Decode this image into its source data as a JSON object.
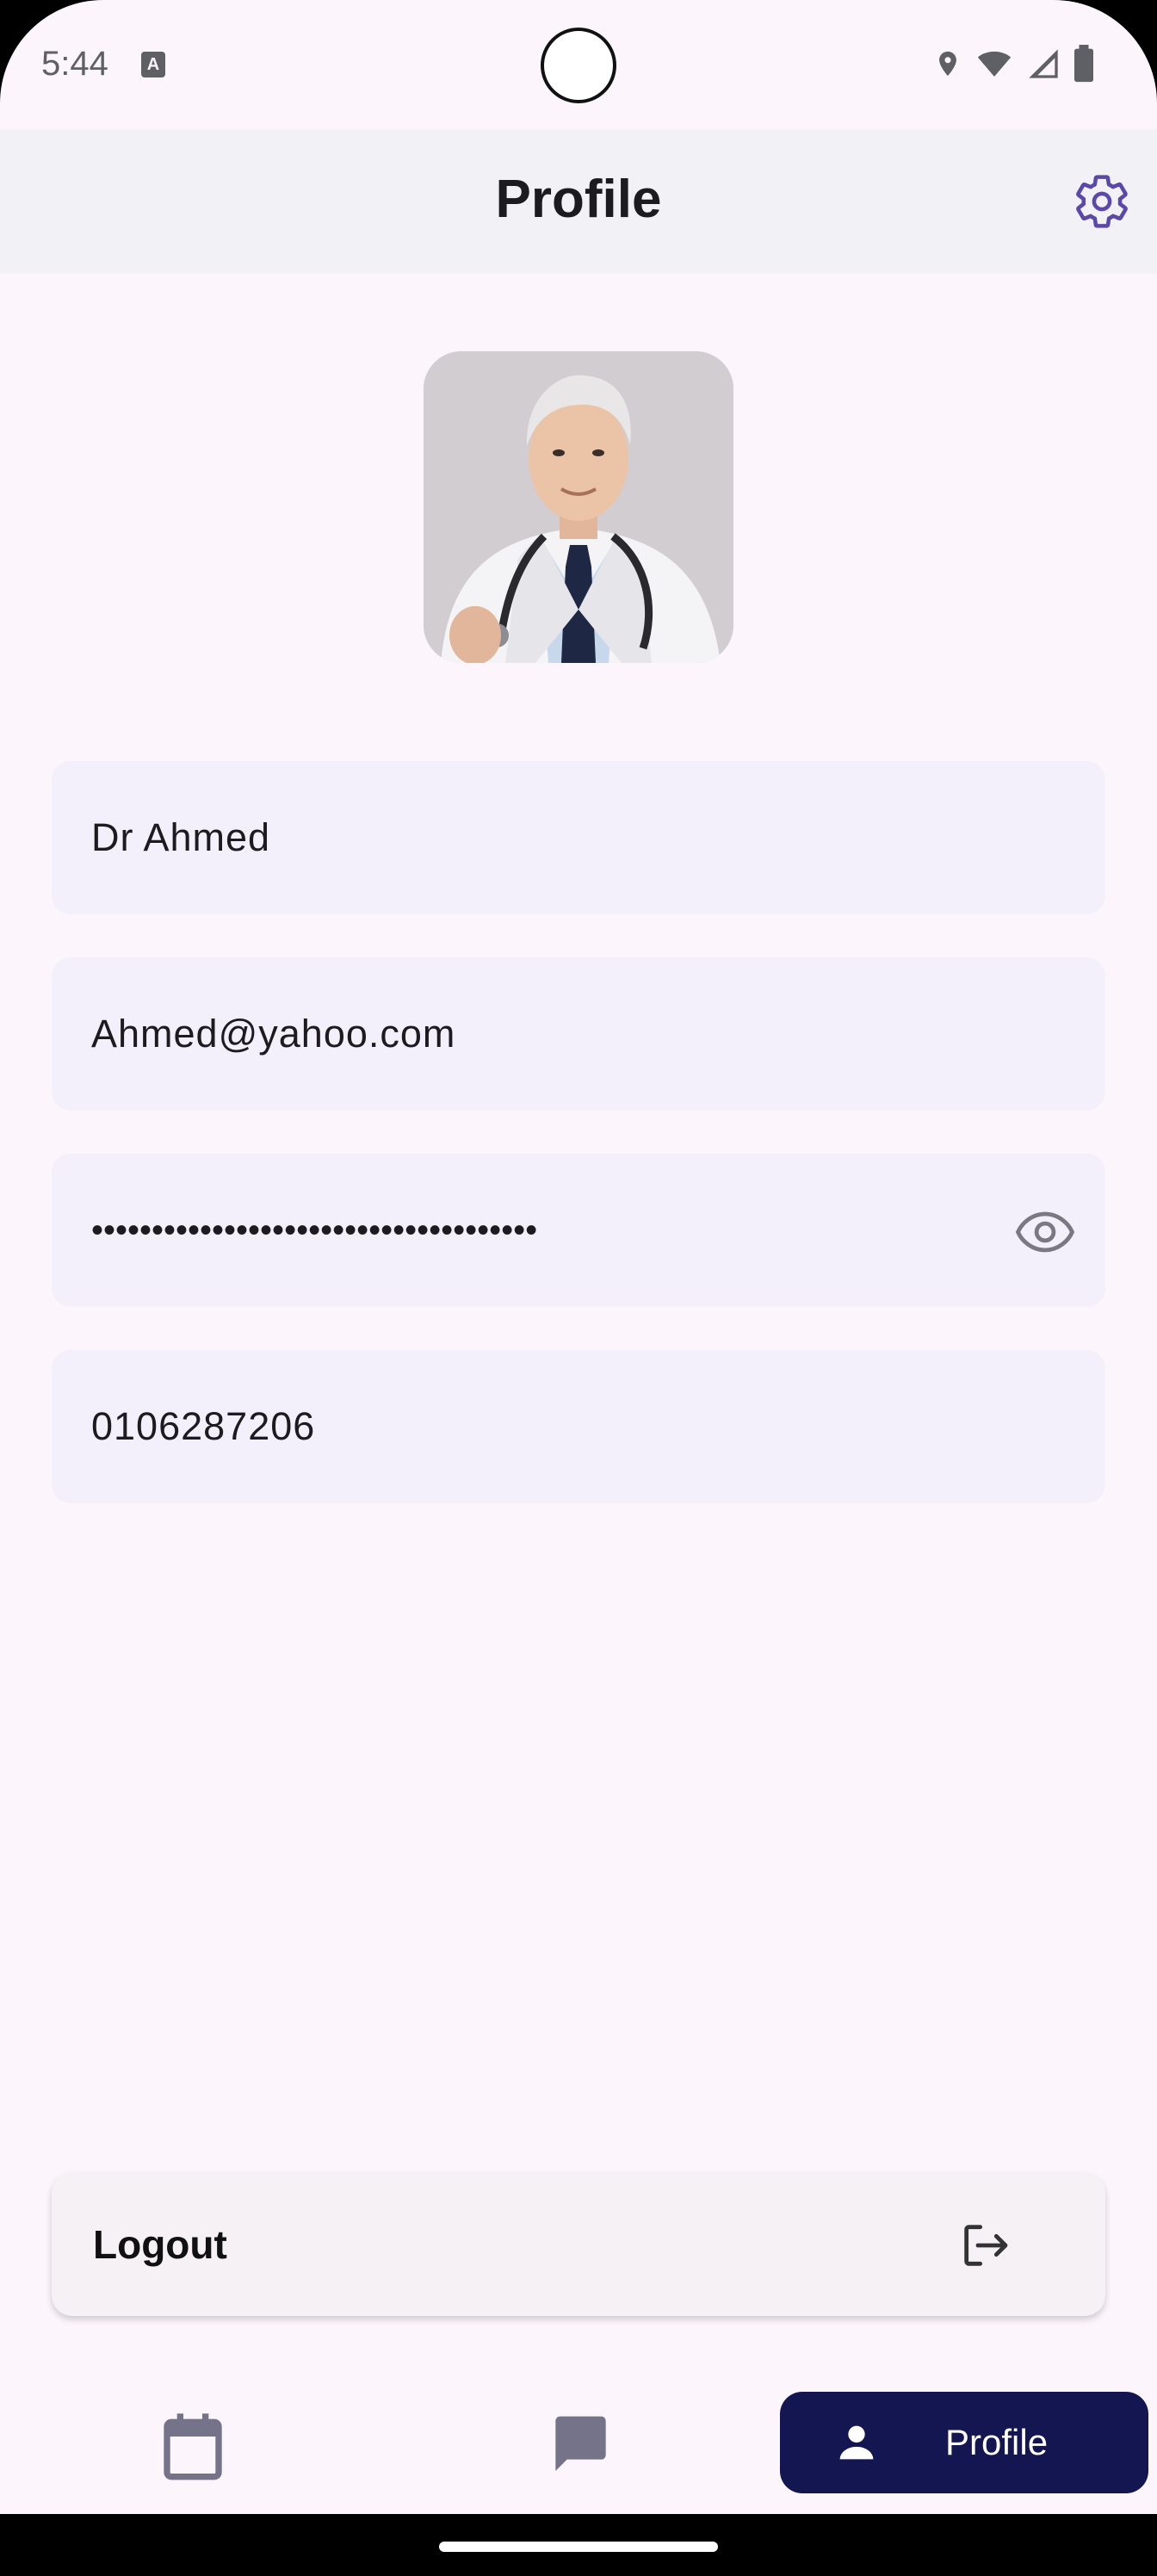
{
  "status_bar": {
    "time": "5:44",
    "app_icon_letter": "A"
  },
  "app_bar": {
    "title": "Profile"
  },
  "profile": {
    "name": "Dr Ahmed",
    "email": "Ahmed@yahoo.com",
    "password_masked": "•••••••••••••••••••••••••••••••••••••",
    "phone": "0106287206"
  },
  "logout": {
    "label": "Logout"
  },
  "bottom_nav": {
    "items": [
      {
        "icon": "calendar-icon"
      },
      {
        "icon": "chat-icon"
      },
      {
        "icon": "person-icon",
        "label": "Profile",
        "selected": true
      }
    ]
  },
  "colors": {
    "accent": "#5b48a8",
    "nav_selected_bg": "#131650",
    "field_bg": "#f3f0fb"
  }
}
